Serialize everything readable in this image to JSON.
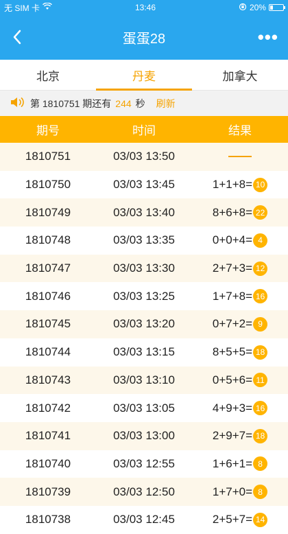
{
  "status_bar": {
    "carrier": "无 SIM 卡",
    "time": "13:46",
    "battery": "20%"
  },
  "nav": {
    "title": "蛋蛋28"
  },
  "tabs": [
    {
      "label": "北京",
      "active": false
    },
    {
      "label": "丹麦",
      "active": true
    },
    {
      "label": "加拿大",
      "active": false
    }
  ],
  "notice": {
    "prefix": "第 1810751 期还有",
    "seconds": "244",
    "suffix": "秒",
    "refresh": "刷新"
  },
  "table": {
    "headers": [
      "期号",
      "时间",
      "结果"
    ],
    "rows": [
      {
        "issue": "1810751",
        "time": "03/03 13:50",
        "formula": "",
        "sum": ""
      },
      {
        "issue": "1810750",
        "time": "03/03 13:45",
        "formula": "1+1+8=",
        "sum": "10"
      },
      {
        "issue": "1810749",
        "time": "03/03 13:40",
        "formula": "8+6+8=",
        "sum": "22"
      },
      {
        "issue": "1810748",
        "time": "03/03 13:35",
        "formula": "0+0+4=",
        "sum": "4"
      },
      {
        "issue": "1810747",
        "time": "03/03 13:30",
        "formula": "2+7+3=",
        "sum": "12"
      },
      {
        "issue": "1810746",
        "time": "03/03 13:25",
        "formula": "1+7+8=",
        "sum": "16"
      },
      {
        "issue": "1810745",
        "time": "03/03 13:20",
        "formula": "0+7+2=",
        "sum": "9"
      },
      {
        "issue": "1810744",
        "time": "03/03 13:15",
        "formula": "8+5+5=",
        "sum": "18"
      },
      {
        "issue": "1810743",
        "time": "03/03 13:10",
        "formula": "0+5+6=",
        "sum": "11"
      },
      {
        "issue": "1810742",
        "time": "03/03 13:05",
        "formula": "4+9+3=",
        "sum": "16"
      },
      {
        "issue": "1810741",
        "time": "03/03 13:00",
        "formula": "2+9+7=",
        "sum": "18"
      },
      {
        "issue": "1810740",
        "time": "03/03 12:55",
        "formula": "1+6+1=",
        "sum": "8"
      },
      {
        "issue": "1810739",
        "time": "03/03 12:50",
        "formula": "1+7+0=",
        "sum": "8"
      },
      {
        "issue": "1810738",
        "time": "03/03 12:45",
        "formula": "2+5+7=",
        "sum": "14"
      }
    ]
  },
  "colors": {
    "header": "#2aa7ee",
    "accent": "#f5a300",
    "table_head": "#ffb400",
    "alt_row": "#fdf7ea"
  }
}
